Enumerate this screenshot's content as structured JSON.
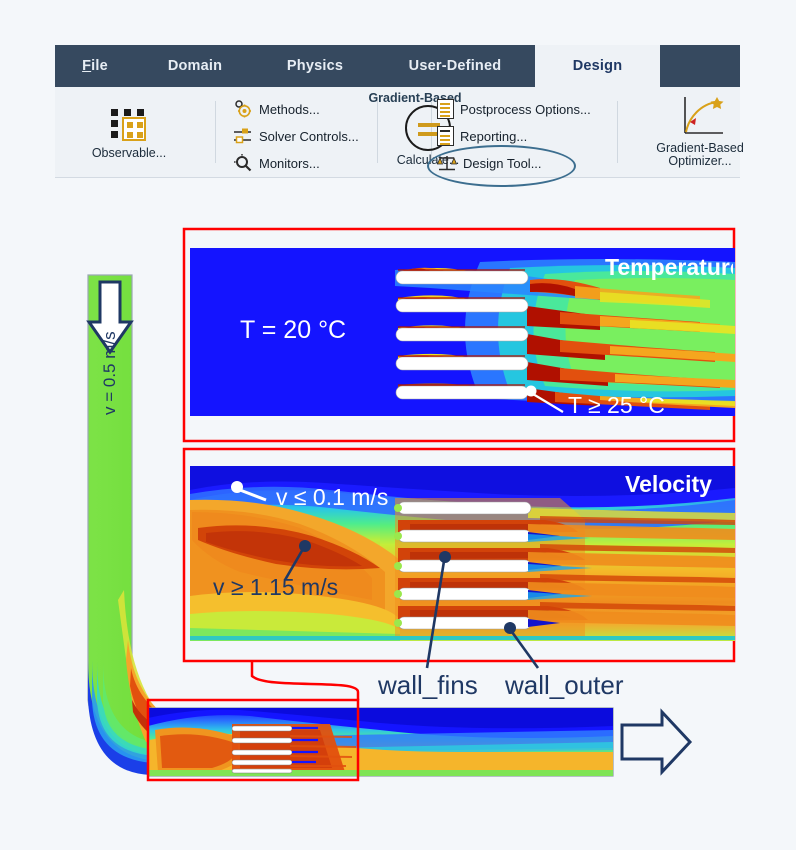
{
  "ribbon": {
    "tabs": [
      {
        "label": "File",
        "accel": "F",
        "active": false,
        "name": "tab-file"
      },
      {
        "label": "Domain",
        "active": false,
        "name": "tab-domain"
      },
      {
        "label": "Physics",
        "active": false,
        "name": "tab-physics"
      },
      {
        "label": "User-Defined",
        "active": false,
        "name": "tab-user-defined"
      },
      {
        "label": "Design",
        "active": true,
        "name": "tab-design"
      }
    ],
    "group_title": "Gradient-Based",
    "observable_label": "Observable...",
    "methods_label": "Methods...",
    "solver_controls_label": "Solver Controls...",
    "monitors_label": "Monitors...",
    "calculate_label": "Calculate...",
    "postprocess_label": "Postprocess Options...",
    "reporting_label": "Reporting...",
    "design_tool_label": "Design Tool...",
    "optimizer_label_line1": "Gradient-Based",
    "optimizer_label_line2": "Optimizer...",
    "colors": {
      "tabbar_bg": "#36495f",
      "tab_text": "#e7edf4",
      "active_tab_bg": "#eef2f6",
      "active_tab_text": "#1f3864",
      "ribbon_bg": "#eef2f6",
      "icon_gold": "#d9a119",
      "highlight_ring": "#3c6e8f"
    }
  },
  "figure": {
    "temperature_panel": {
      "title": "Temperature",
      "inlet_temp_label": "T = 20 °C",
      "hotspot_label": "T ≥ 25 °C",
      "background_color": "#1414ff"
    },
    "velocity_panel": {
      "title": "Velocity",
      "low_velocity_label": "v ≤ 0.1 m/s",
      "high_velocity_label": "v ≥ 1.15 m/s"
    },
    "inlet_label": "v = 0.5 m/s",
    "boundary_labels": [
      {
        "text": "wall_fins"
      },
      {
        "text": "wall_outer"
      }
    ],
    "colors": {
      "callout_red": "#ff0000",
      "annotation_navy": "#1f3864",
      "arrow_outline": "#1f3864",
      "inlet_green": "#6ce03a"
    },
    "fin_count": 5
  }
}
